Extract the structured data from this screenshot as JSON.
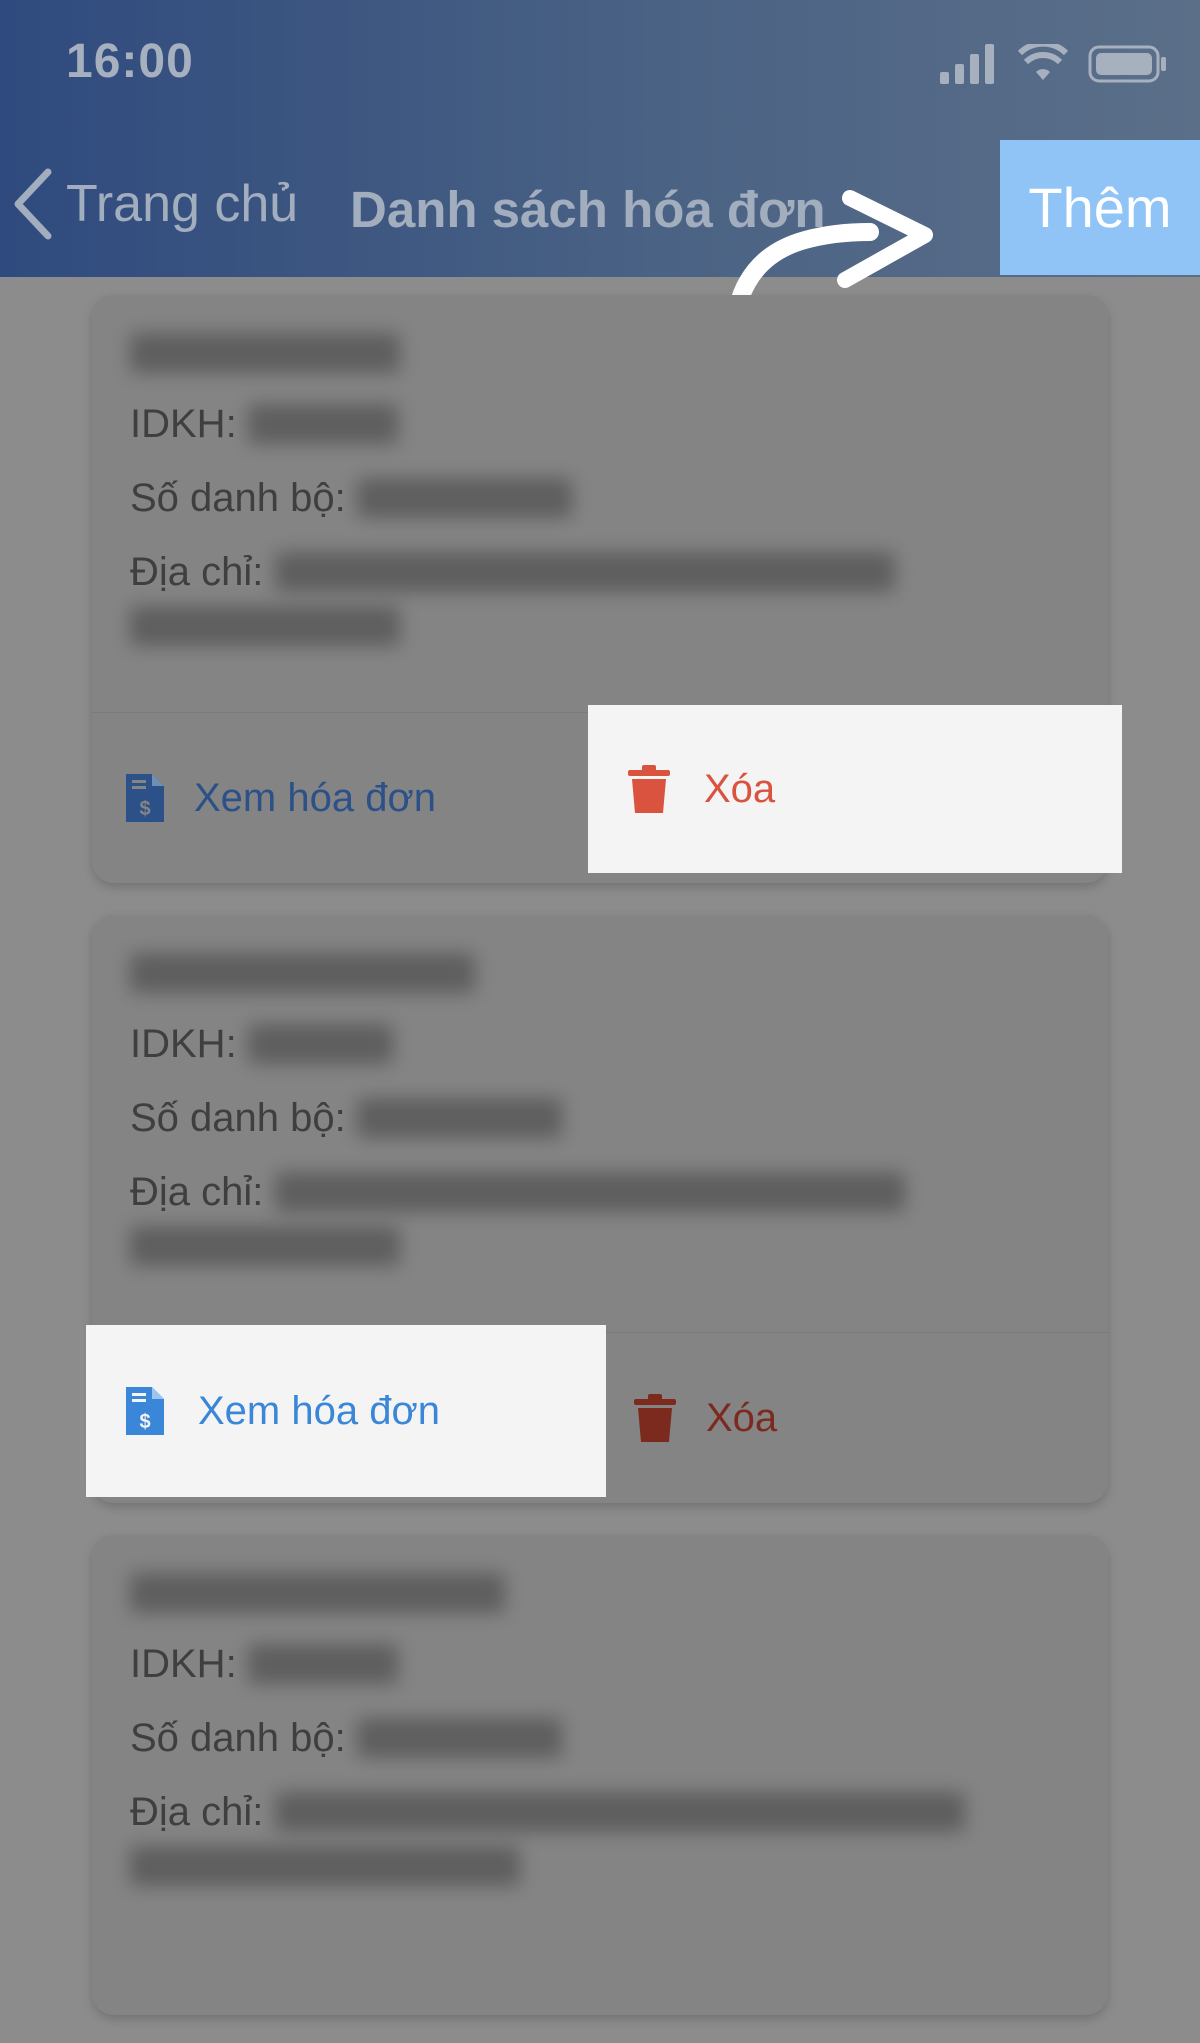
{
  "status_bar": {
    "time": "16:00"
  },
  "nav": {
    "back_label": "Trang chủ",
    "title": "Danh sách hóa đơn",
    "add_label": "Thêm"
  },
  "labels": {
    "idkh": "IDKH: ",
    "so_danh_bo": "Số danh bộ: ",
    "dia_chi": "Địa chỉ: ",
    "view_invoice": "Xem hóa đơn",
    "delete": "Xóa"
  },
  "colors": {
    "accent_blue": "#3a86d9",
    "delete_red": "#d9533f",
    "add_button_bg": "#90c4f6"
  },
  "icons": [
    "chevron-left-icon",
    "signal-icon",
    "wifi-icon",
    "battery-icon",
    "invoice-icon",
    "trash-icon",
    "curved-arrow-icon"
  ]
}
